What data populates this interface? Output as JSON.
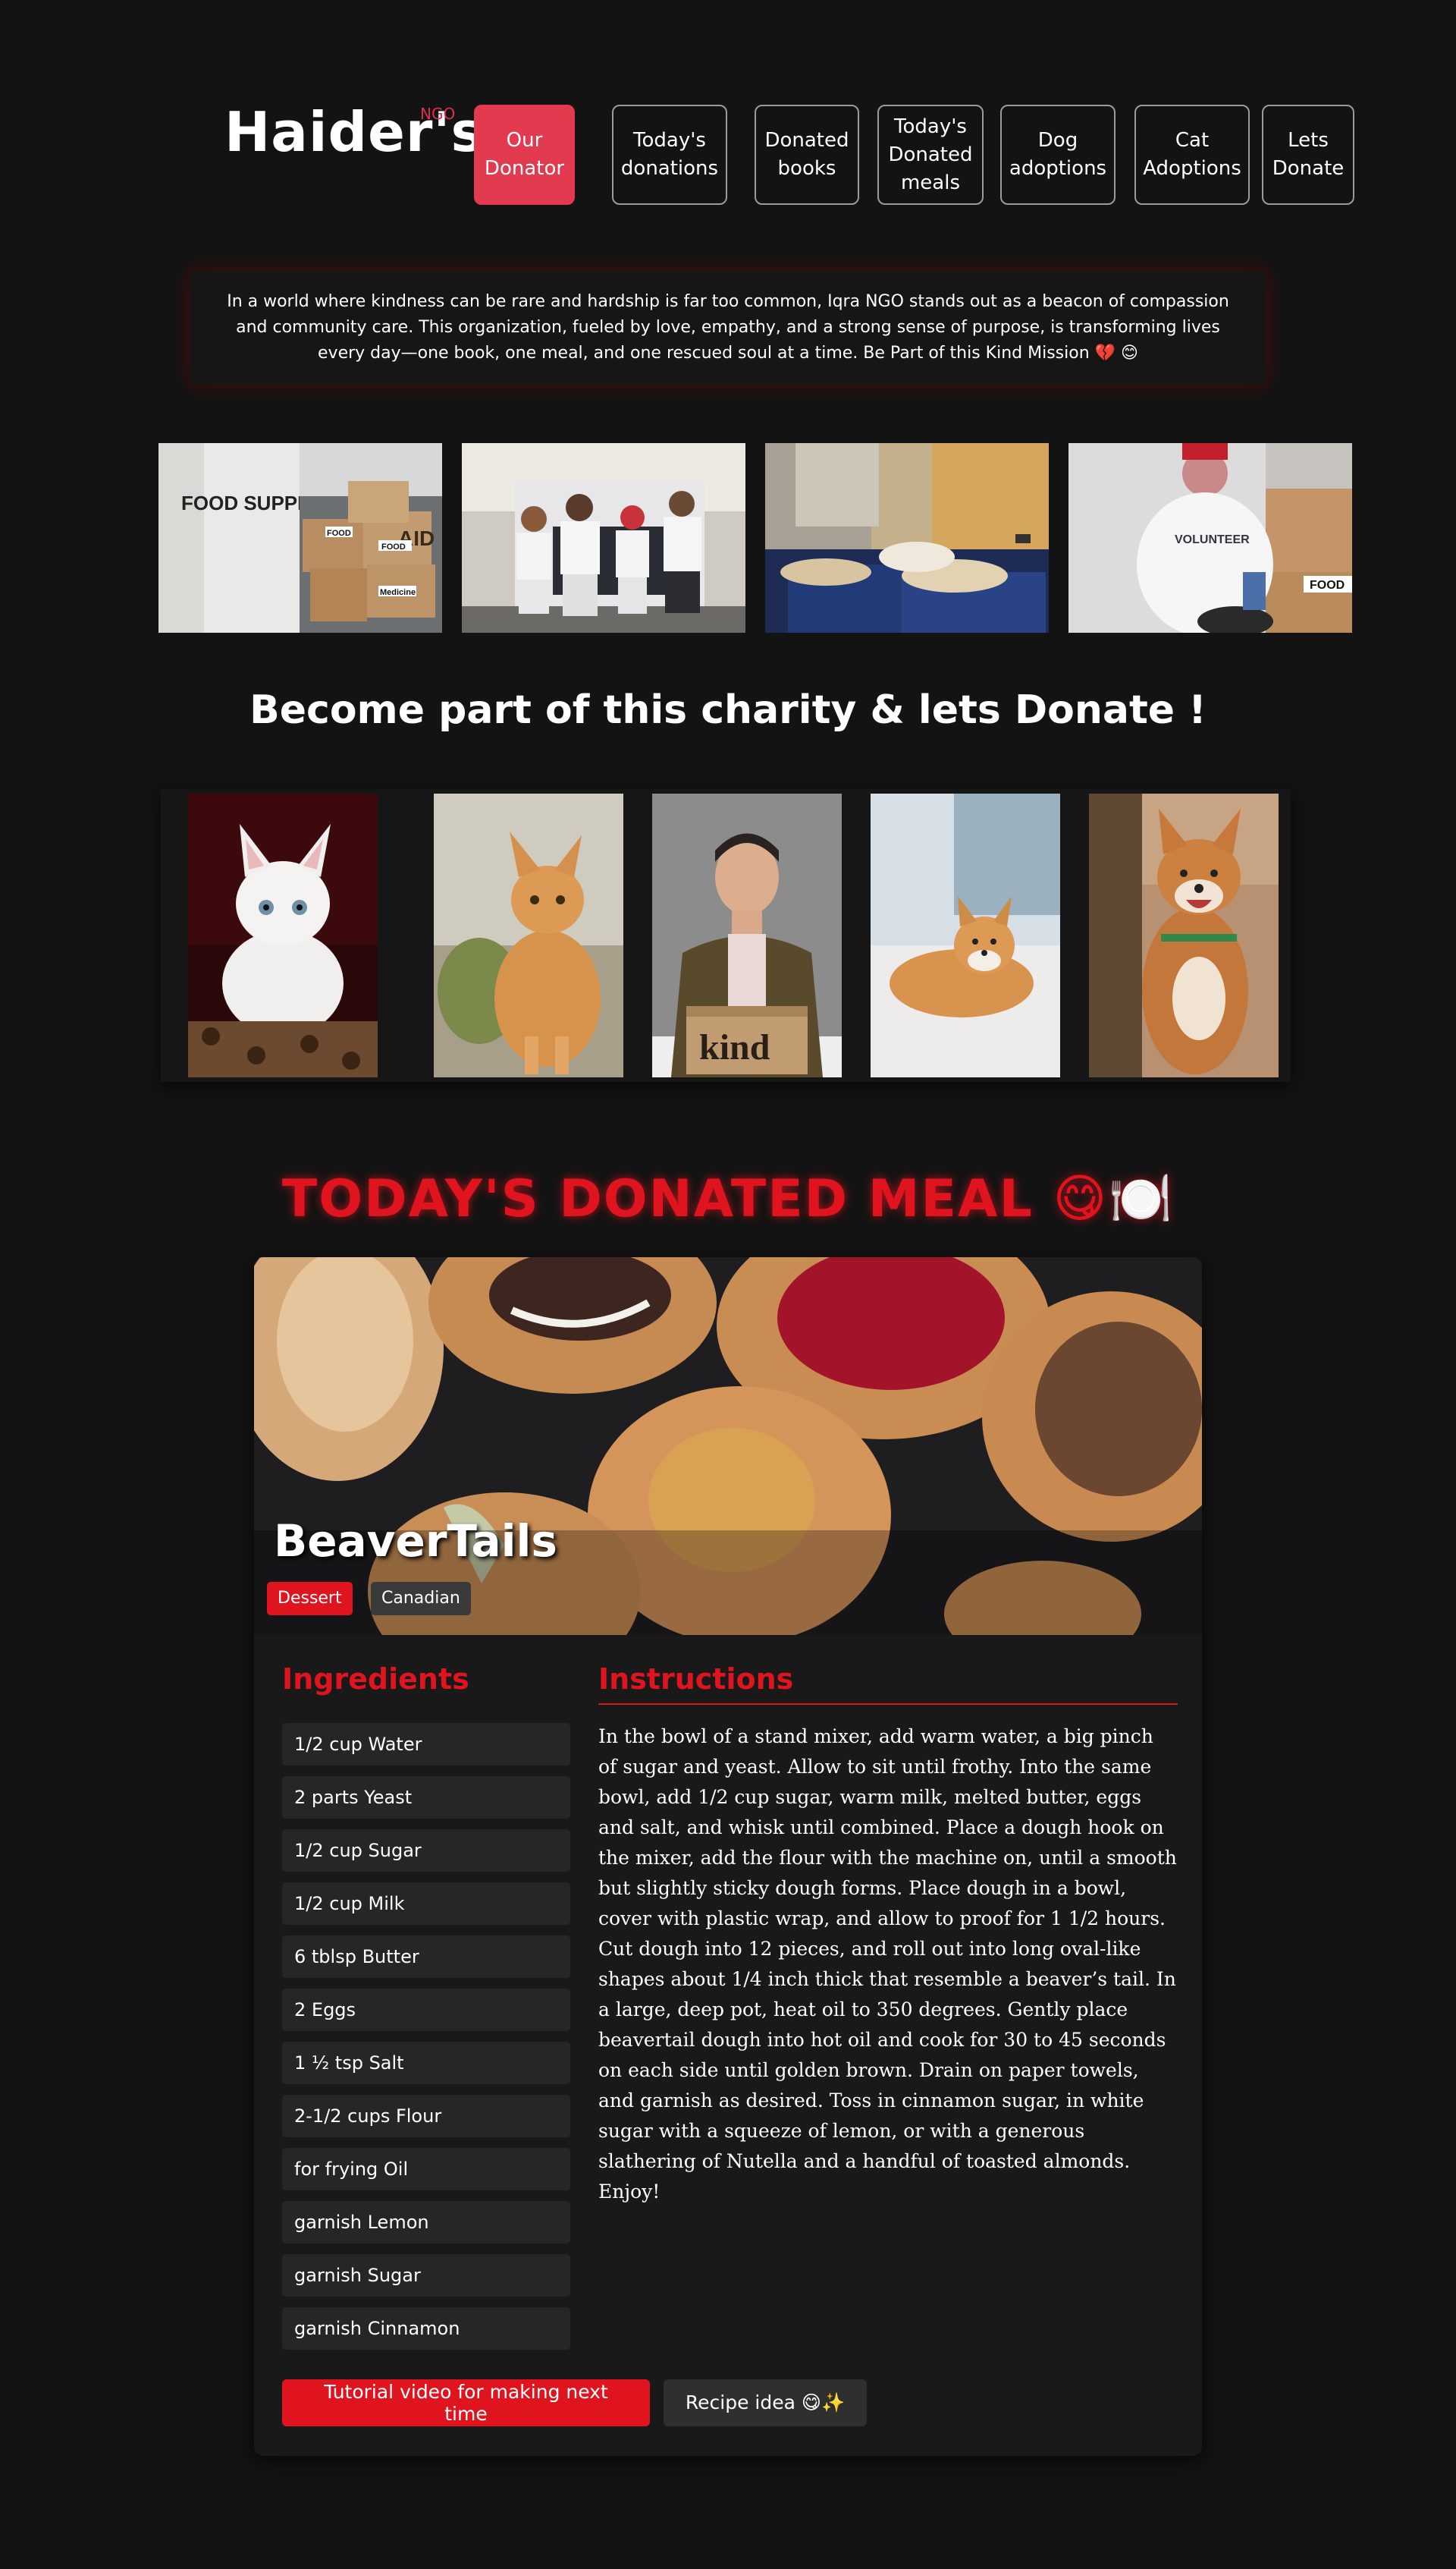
{
  "header": {
    "brand": "Haider's",
    "tag": "NGO",
    "nav": [
      {
        "label": "Our\nDonator",
        "active": true
      },
      {
        "label": "Today's\ndonations"
      },
      {
        "label": "Donated\nbooks"
      },
      {
        "label": "Today's\nDonated\nmeals"
      },
      {
        "label": "Dog\nadoptions"
      },
      {
        "label": "Cat\nAdoptions"
      },
      {
        "label": "Lets\nDonate"
      }
    ]
  },
  "intro": "In a world where kindness can be rare and hardship is far too common, Iqra NGO stands out as a beacon of compassion and community care. This organization, fueled by love, empathy, and a strong sense of purpose, is transforming lives every day—one book, one meal, and one rescued soul at a time. Be Part of this Kind Mission 💔 😊",
  "photos": {
    "food_supplies_text": "FOOD SUPPLIES",
    "box_labels": [
      "AID",
      "FOOD",
      "FOOD",
      "Medicine"
    ],
    "volunteer_text": "VOLUNTEER",
    "food_box_text": "FOOD"
  },
  "slogan": "Become part of this charity & lets Donate !",
  "gallery": {
    "kind_box_text": "kind"
  },
  "meal": {
    "section_title": "TODAY'S DONATED MEAL 😋🍽️",
    "name": "BeaverTails",
    "tags": [
      "Dessert",
      "Canadian"
    ],
    "ingredients_title": "Ingredients",
    "instructions_title": "Instructions",
    "ingredients": [
      "1/2 cup Water",
      "2 parts Yeast",
      "1/2 cup Sugar",
      "1/2 cup Milk",
      "6 tblsp Butter",
      "2 Eggs",
      "1 ½ tsp Salt",
      "2-1/2 cups Flour",
      "for frying Oil",
      "garnish Lemon",
      "garnish Sugar",
      "garnish Cinnamon"
    ],
    "instructions": "In the bowl of a stand mixer, add warm water, a big pinch of sugar and yeast. Allow to sit until frothy. Into the same bowl, add 1/2 cup sugar, warm milk, melted butter, eggs and salt, and whisk until combined. Place a dough hook on the mixer, add the flour with the machine on, until a smooth but slightly sticky dough forms. Place dough in a bowl, cover with plastic wrap, and allow to proof for 1 1/2 hours. Cut dough into 12 pieces, and roll out into long oval-like shapes about 1/4 inch thick that resemble a beaver’s tail. In a large, deep pot, heat oil to 350 degrees. Gently place beavertail dough into hot oil and cook for 30 to 45 seconds on each side until golden brown. Drain on paper towels, and garnish as desired. Toss in cinnamon sugar, in white sugar with a squeeze of lemon, or with a generous slathering of Nutella and a handful of toasted almonds. Enjoy!",
    "video_button": "Tutorial video for making next time",
    "idea_button": "Recipe idea 😋✨"
  },
  "colors": {
    "accent": "#e0141e",
    "nav_active": "#e23a4e",
    "background": "#131313"
  }
}
